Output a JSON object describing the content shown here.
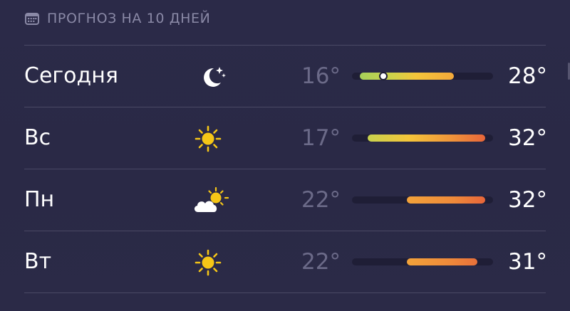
{
  "header": {
    "icon": "calendar-icon",
    "title": "ПРОГНОЗ НА 10 ДНЕЙ"
  },
  "range": {
    "min": 15,
    "max": 33
  },
  "colors": {
    "background": "#2b2a47",
    "separator": "#4a4965",
    "low_text": "#6b6a88",
    "track": "#1f1e36",
    "green": "#a6d15a",
    "yellow": "#f4c53a",
    "orange": "#f09a3a",
    "red_orange": "#e8603a"
  },
  "days": [
    {
      "label": "Сегодня",
      "icon": "moon-stars-icon",
      "low": "16°",
      "high": "28°",
      "low_value": 16,
      "high_value": 28,
      "current_value": 19,
      "gradient": "linear-gradient(90deg, #a6d15a 0%, #cfd24a 35%, #f4c53a 60%, #f3a93a 100%)"
    },
    {
      "label": "Вс",
      "icon": "sun-icon",
      "low": "17°",
      "high": "32°",
      "low_value": 17,
      "high_value": 32,
      "gradient": "linear-gradient(90deg, #c8d24e 0%, #f4c53a 35%, #f0963a 70%, #e8663a 100%)"
    },
    {
      "label": "Пн",
      "icon": "partly-cloudy-icon",
      "low": "22°",
      "high": "32°",
      "low_value": 22,
      "high_value": 32,
      "gradient": "linear-gradient(90deg, #f3a33a 0%, #ef8a3a 60%, #e8663a 100%)"
    },
    {
      "label": "Вт",
      "icon": "sun-icon",
      "low": "22°",
      "high": "31°",
      "low_value": 22,
      "high_value": 31,
      "gradient": "linear-gradient(90deg, #f3a33a 0%, #ef8a3a 60%, #e8703a 100%)"
    }
  ]
}
